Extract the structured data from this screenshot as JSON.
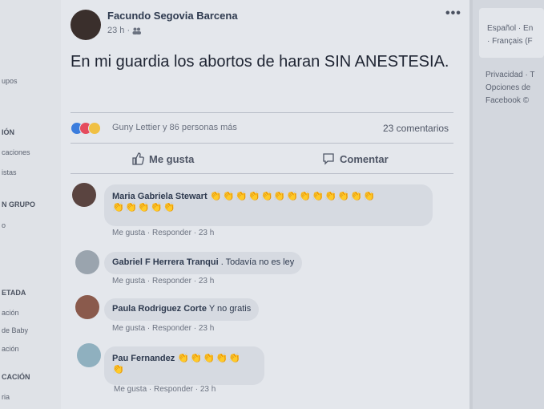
{
  "left_sidebar": {
    "items": [
      "upos",
      "IÓN",
      "caciones",
      "istas",
      "N GRUPO",
      "o",
      "ETADA",
      "ación",
      "de Baby",
      "ación",
      "CACIÓN",
      "ria"
    ]
  },
  "right_sidebar": {
    "lang_line1": "Español · En",
    "lang_line2": "· Français (F",
    "footer1": "Privacidad · T",
    "footer2": "Opciones de",
    "footer3": "Facebook ©"
  },
  "post": {
    "author": "Facundo Segovia Barcena",
    "meta": "23 h · ",
    "menu_icon": "•••",
    "text": "En mi guardia los abortos de haran SIN ANESTESIA.",
    "reaction_names": "Guny Lettier y 86 personas más",
    "comment_count": "23 comentarios",
    "like_label": "Me gusta",
    "comment_label": "Comentar"
  },
  "comments": [
    {
      "name": "Maria Gabriela Stewart",
      "text": "",
      "emojis_line1": "👏👏👏👏👏👏👏👏👏👏👏👏👏",
      "emojis_line2": "👏👏👏👏👏",
      "meta": "Me gusta · Responder · 23 h"
    },
    {
      "name": "Gabriel F Herrera Tranqui",
      "text": ". Todavía no es ley",
      "meta": "Me gusta · Responder · 23 h"
    },
    {
      "name": "Paula Rodriguez Corte",
      "text": "Y no gratis",
      "meta": "Me gusta · Responder · 23 h"
    },
    {
      "name": "Pau Fernandez",
      "text": "",
      "emojis_line1": "👏👏👏👏👏",
      "emojis_line2": "👏",
      "meta": "Me gusta · Responder · 23 h"
    }
  ],
  "colors": {
    "accent": "#3b7ddd",
    "background": "#e4e7ec"
  }
}
